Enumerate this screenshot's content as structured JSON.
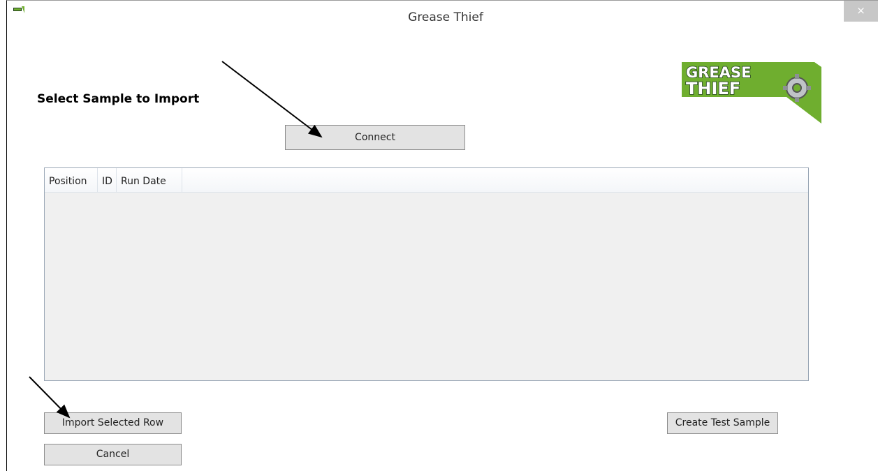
{
  "window": {
    "title": "Grease Thief",
    "close_label": "×"
  },
  "logo": {
    "line1": "GREASE",
    "line2": "THIEF"
  },
  "main": {
    "heading": "Select Sample to Import",
    "connect_label": "Connect",
    "table": {
      "columns": [
        "Position",
        "ID",
        "Run Date"
      ],
      "rows": []
    },
    "import_label": "Import Selected Row",
    "cancel_label": "Cancel",
    "create_test_label": "Create Test Sample"
  },
  "colors": {
    "logo_green": "#6fae2f",
    "logo_dark": "#1e3a1e",
    "grid_border": "#9aa7b6",
    "button_face": "#e3e3e3"
  }
}
